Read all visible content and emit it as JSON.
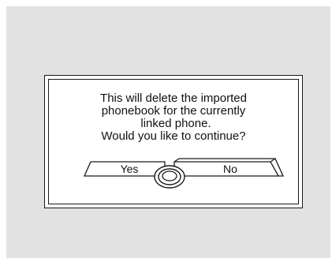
{
  "dialog": {
    "message_lines": [
      "This will delete the imported",
      "phonebook for the currently",
      "linked phone.",
      "Would  you like to continue?"
    ],
    "yes_label": "Yes",
    "no_label": "No",
    "selected": "No"
  },
  "colors": {
    "screen_background": "#e2e2e3",
    "dialog_background": "#ffffff",
    "outline": "#1a1a1a",
    "text": "#111111"
  },
  "icons": {
    "interface_dial": "selector-knob-icon"
  }
}
